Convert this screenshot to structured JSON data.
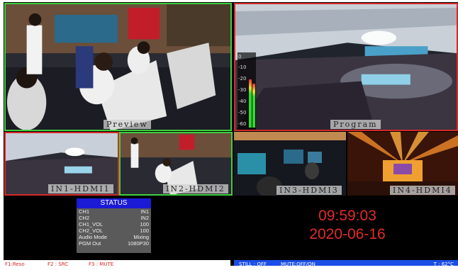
{
  "panes": {
    "preview": {
      "label": "Preview"
    },
    "program": {
      "label": "Program"
    },
    "in1": {
      "label": "IN1-HDMI1"
    },
    "in2": {
      "label": "IN2-HDMI2"
    },
    "in3": {
      "label": "IN3-HDMI3"
    },
    "in4": {
      "label": "IN4-HDMI4"
    }
  },
  "audio_meter": {
    "ticks": [
      "0",
      "-10",
      "-20",
      "-30",
      "-40",
      "-50",
      "-60"
    ],
    "left_level": 0.68,
    "right_level": 0.62
  },
  "status": {
    "title": "STATUS",
    "rows": [
      {
        "key": "CH1",
        "value": "IN1"
      },
      {
        "key": "CH2",
        "value": "IN2"
      },
      {
        "key": "CH1_VOL",
        "value": "100"
      },
      {
        "key": "CH2_VOL",
        "value": "100"
      },
      {
        "key": "Audio Mode",
        "value": "Mixing"
      },
      {
        "key": "PGM Out",
        "value": "1080P30"
      }
    ]
  },
  "clock": {
    "time": "09:59:03",
    "date": "2020-06-16"
  },
  "bottom_bar": {
    "f1": "F1:Reso",
    "f2": "F2 : SRC",
    "f3": "F3 : MUTE",
    "still": "STILL : OFF",
    "mute": "MUTE:OFF/ON",
    "temp": "T : 62°C"
  },
  "colors": {
    "preview_border": "#3fcf3f",
    "program_border": "#d42a2a",
    "status_title": "#1b1bd6",
    "clock": "#e22a2a",
    "bar_right": "#1a4ee6"
  }
}
